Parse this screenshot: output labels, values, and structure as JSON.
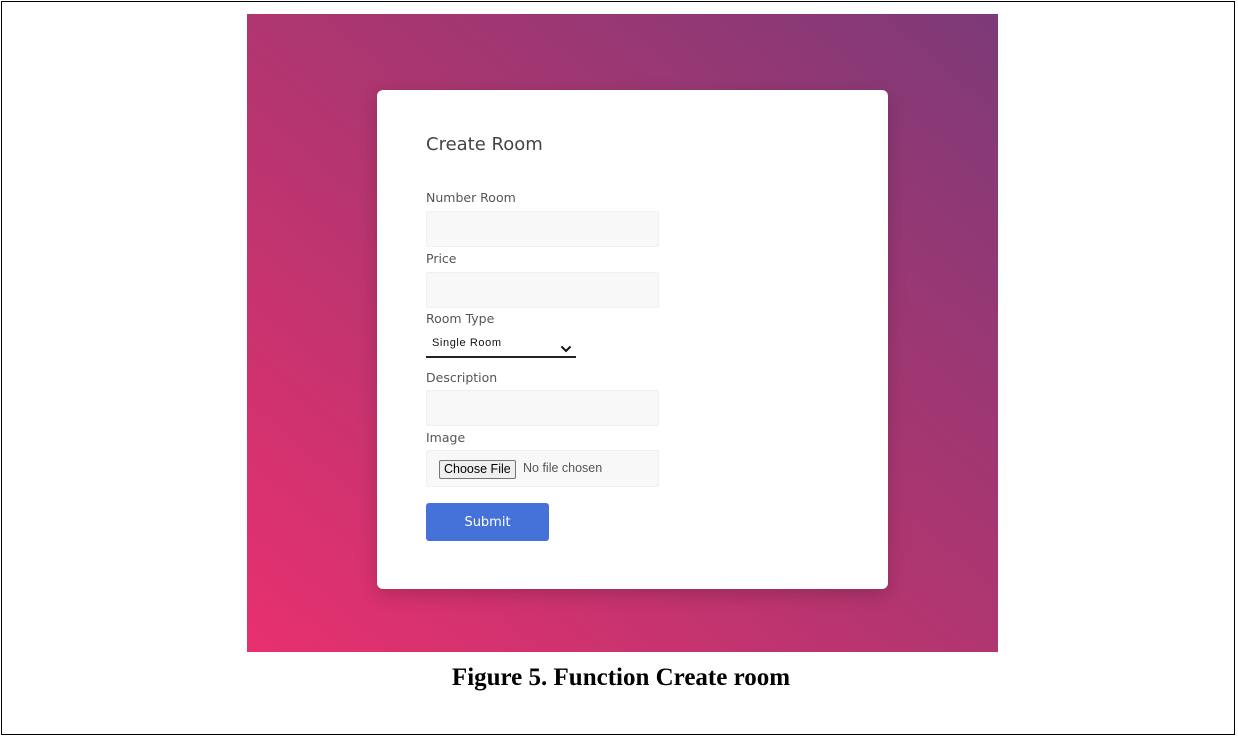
{
  "form": {
    "title": "Create Room",
    "number_room_label": "Number Room",
    "number_room_value": "",
    "price_label": "Price",
    "price_value": "",
    "room_type_label": "Room Type",
    "room_type_selected": "Single Room",
    "description_label": "Description",
    "description_value": "",
    "image_label": "Image",
    "choose_file_label": "Choose File",
    "no_file_text": "No file chosen",
    "submit_label": "Submit"
  },
  "caption": "Figure 5. Function Create room",
  "colors": {
    "gradient_start": "#e8306f",
    "gradient_end": "#7d3a78",
    "submit_button": "#4472d8"
  },
  "icons": {
    "select_chevron": "chevron-down-icon"
  }
}
